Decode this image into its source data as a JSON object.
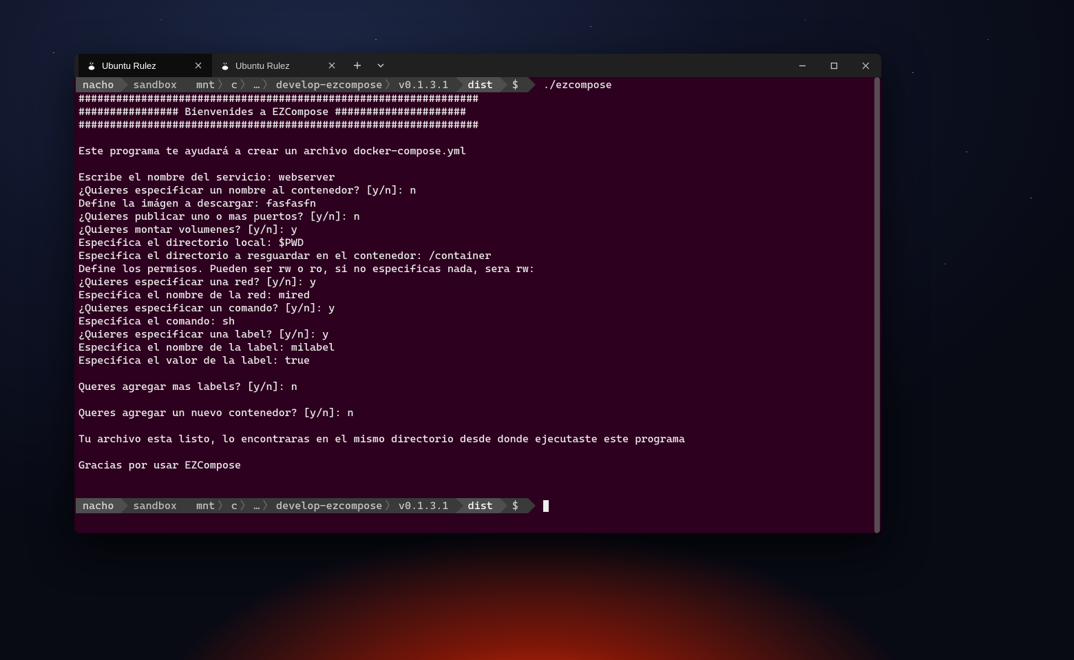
{
  "tabs": [
    {
      "title": "Ubuntu Rulez",
      "active": true
    },
    {
      "title": "Ubuntu Rulez",
      "active": false
    }
  ],
  "colors": {
    "termBg": "#2c001e",
    "titlebarBg": "#202020",
    "tabActiveBg": "#0d0d0d",
    "fg": "#eeeeec"
  },
  "prompt": {
    "user": "nacho",
    "machine": "sandbox",
    "path_segments": [
      "mnt",
      "c",
      "…",
      "develop-ezcompose",
      "v0.1.3.1"
    ],
    "path_final": "dist",
    "symbol": "$"
  },
  "command": "./ezcompose",
  "output": [
    "################################################################",
    "################ Bienvenides a EZCompose #####################",
    "################################################################",
    "",
    "Este programa te ayudará a crear un archivo docker-compose.yml",
    "",
    "Escribe el nombre del servicio: webserver",
    "¿Quieres especificar un nombre al contenedor? [y/n]: n",
    "Define la imágen a descargar: fasfasfn",
    "¿Quieres publicar uno o mas puertos? [y/n]: n",
    "¿Quieres montar volumenes? [y/n]: y",
    "Especifica el directorio local: $PWD",
    "Especifica el directorio a resguardar en el contenedor: /container",
    "Define los permisos. Pueden ser rw o ro, si no especificas nada, sera rw:",
    "¿Quieres especificar una red? [y/n]: y",
    "Especifica el nombre de la red: mired",
    "¿Quieres especificar un comando? [y/n]: y",
    "Especifica el comando: sh",
    "¿Quieres especificar una label? [y/n]: y",
    "Especifica el nombre de la label: milabel",
    "Especifica el valor de la label: true",
    "",
    "Queres agregar mas labels? [y/n]: n",
    "",
    "Queres agregar un nuevo contenedor? [y/n]: n",
    "",
    "Tu archivo esta listo, lo encontraras en el mismo directorio desde donde ejecutaste este programa",
    "",
    "Gracias por usar EZCompose",
    "",
    ""
  ]
}
